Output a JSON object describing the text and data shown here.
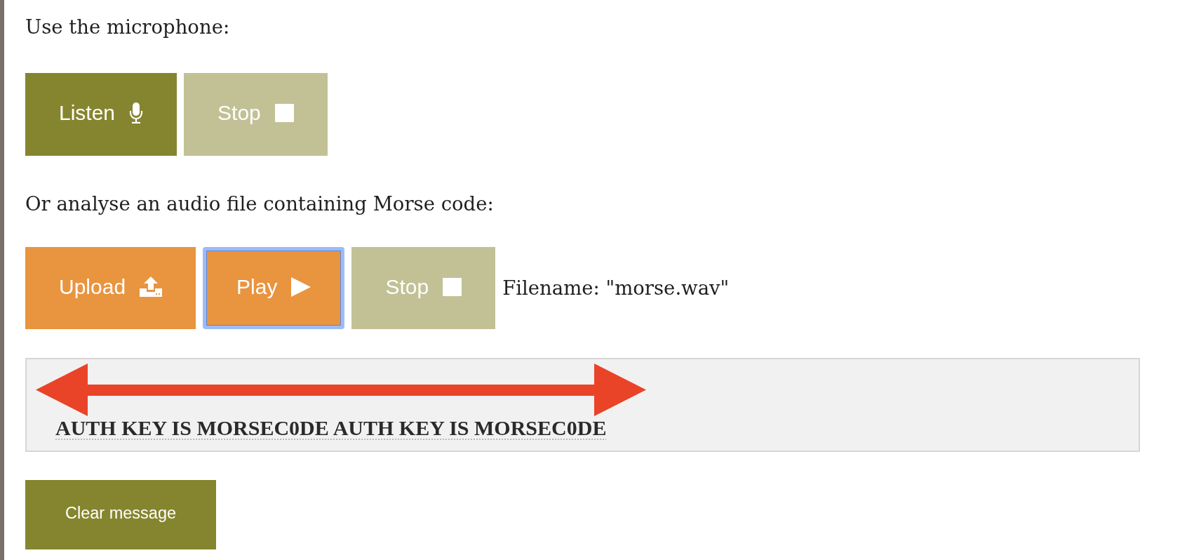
{
  "microphone": {
    "prompt": "Use the microphone:",
    "listen_button": {
      "label": "Listen",
      "kind": "plain",
      "disabled": false,
      "focused": false
    },
    "stop_button": {
      "label": "Stop",
      "kind": "plain",
      "disabled": true,
      "focused": false
    }
  },
  "audio_file": {
    "prompt": "Or analyse an audio file containing Morse code:",
    "upload_button": {
      "label": "Upload",
      "kind": "accent",
      "disabled": false,
      "focused": false
    },
    "play_button": {
      "label": "Play",
      "kind": "accent",
      "disabled": false,
      "focused": true
    },
    "stop_button": {
      "label": "Stop",
      "kind": "plain",
      "disabled": true,
      "focused": false
    },
    "filename": "Filename: \"morse.wav\""
  },
  "message": {
    "text": "AUTH KEY IS MORSEC0DE AUTH KEY IS MORSEC0DE"
  },
  "clear_button": {
    "label": "Clear message",
    "kind": "plain",
    "disabled": false,
    "focused": false
  }
}
